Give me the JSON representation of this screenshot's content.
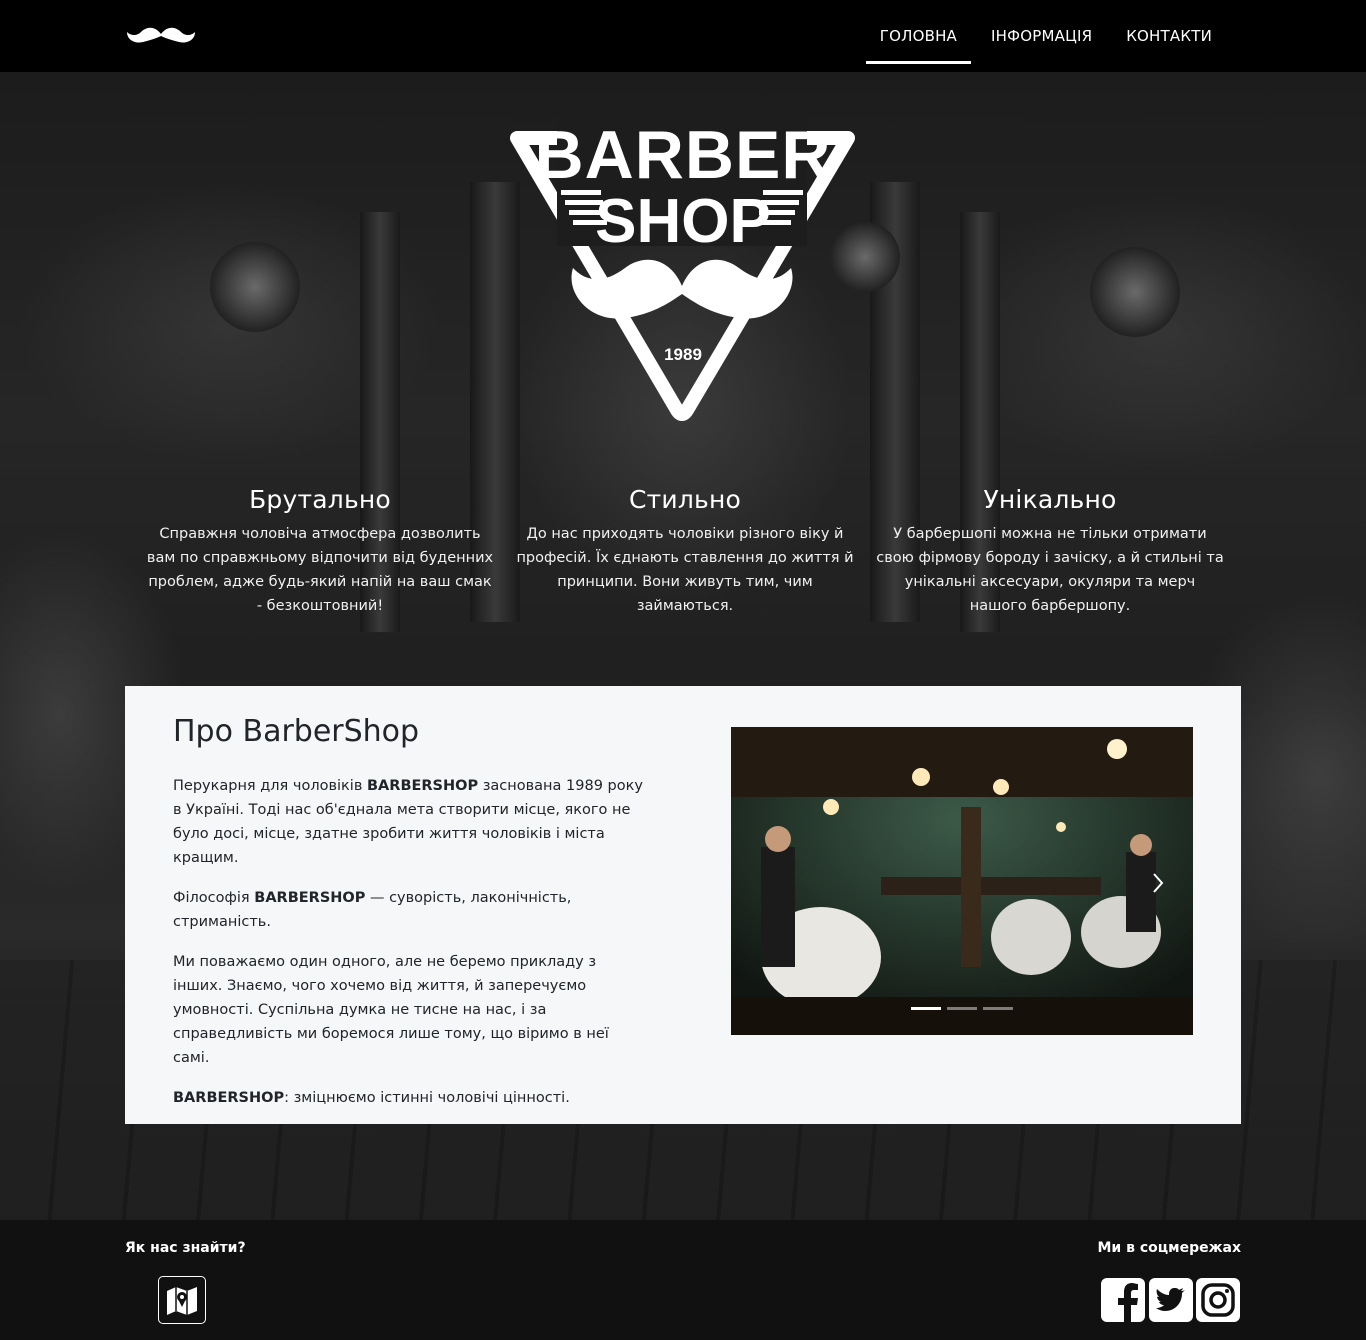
{
  "nav": {
    "logo": "mustache-logo",
    "links": [
      {
        "label": "ГОЛОВНА",
        "active": true
      },
      {
        "label": "ІНФОРМАЦІЯ",
        "active": false
      },
      {
        "label": "КОНТАКТИ",
        "active": false
      }
    ]
  },
  "hero": {
    "logo_text": {
      "line1": "BARBER",
      "line2": "SHOP",
      "year": "1989"
    },
    "features": [
      {
        "title": "Брутально",
        "text": "Справжня чоловіча атмосфера дозволить вам по справжньому відпочити від буденних проблем, адже будь-який напій на ваш смак - безкоштовний!"
      },
      {
        "title": "Стильно",
        "text": "До нас приходять чоловіки різного віку й професій. Їх єднають ставлення до життя й принципи. Вони живуть тим, чим займаються."
      },
      {
        "title": "Унікально",
        "text": "У барбершопі можна не тільки отримати свою фірмову бороду і зачіску, а й стильні та унікальні аксесуари, окуляри та мерч нашого барбершопу."
      }
    ]
  },
  "about": {
    "title": "Про BarberShop",
    "p1_bold": "BARBERSHOP",
    "p1_pre": "Перукарня для чоловіків ",
    "p1_post": " заснована 1989 року в Україні. Тоді нас об'єднала мета створити місце, якого не було досі, місце, здатне зробити життя чоловіків і міста кращим.",
    "p2_pre": "Філософія ",
    "p2_bold": "BARBERSHOP",
    "p2_post": " — суворість, лаконічність, стриманість.",
    "p3": "Ми поважаємо один одного, але не беремо прикладу з інших. Знаємо, чого хочемо від життя, й заперечуємо умовності. Суспільна думка не тисне на нас, і за справедливість ми боремося лише тому, що віримо в неї самі.",
    "p4_bold": "BARBERSHOP",
    "p4_post": ": зміцнюємо істинні чоловічі цінності.",
    "carousel": {
      "slides": 3,
      "active": 0
    }
  },
  "footer": {
    "find_title": "Як нас знайти?",
    "social_title": "Ми в соцмережах",
    "icons": [
      "map-icon",
      "facebook-icon",
      "twitter-icon",
      "instagram-icon"
    ]
  }
}
